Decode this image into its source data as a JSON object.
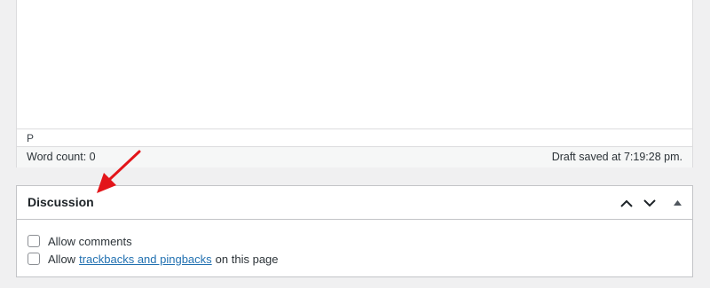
{
  "editor": {
    "path": "P",
    "word_count": "Word count: 0",
    "draft_status": "Draft saved at 7:19:28 pm."
  },
  "discussion": {
    "title": "Discussion",
    "allow_comments": {
      "label": "Allow comments",
      "checked": false
    },
    "allow_pings": {
      "prefix": "Allow",
      "link_text": "trackbacks and pingbacks",
      "suffix": "on this page",
      "checked": false
    },
    "controls": [
      "chevron-up-icon",
      "chevron-down-icon",
      "triangle-up-icon"
    ]
  },
  "colors": {
    "accent_link": "#2271b1",
    "annotation_arrow": "#e3151a",
    "background": "#f0f0f1"
  }
}
